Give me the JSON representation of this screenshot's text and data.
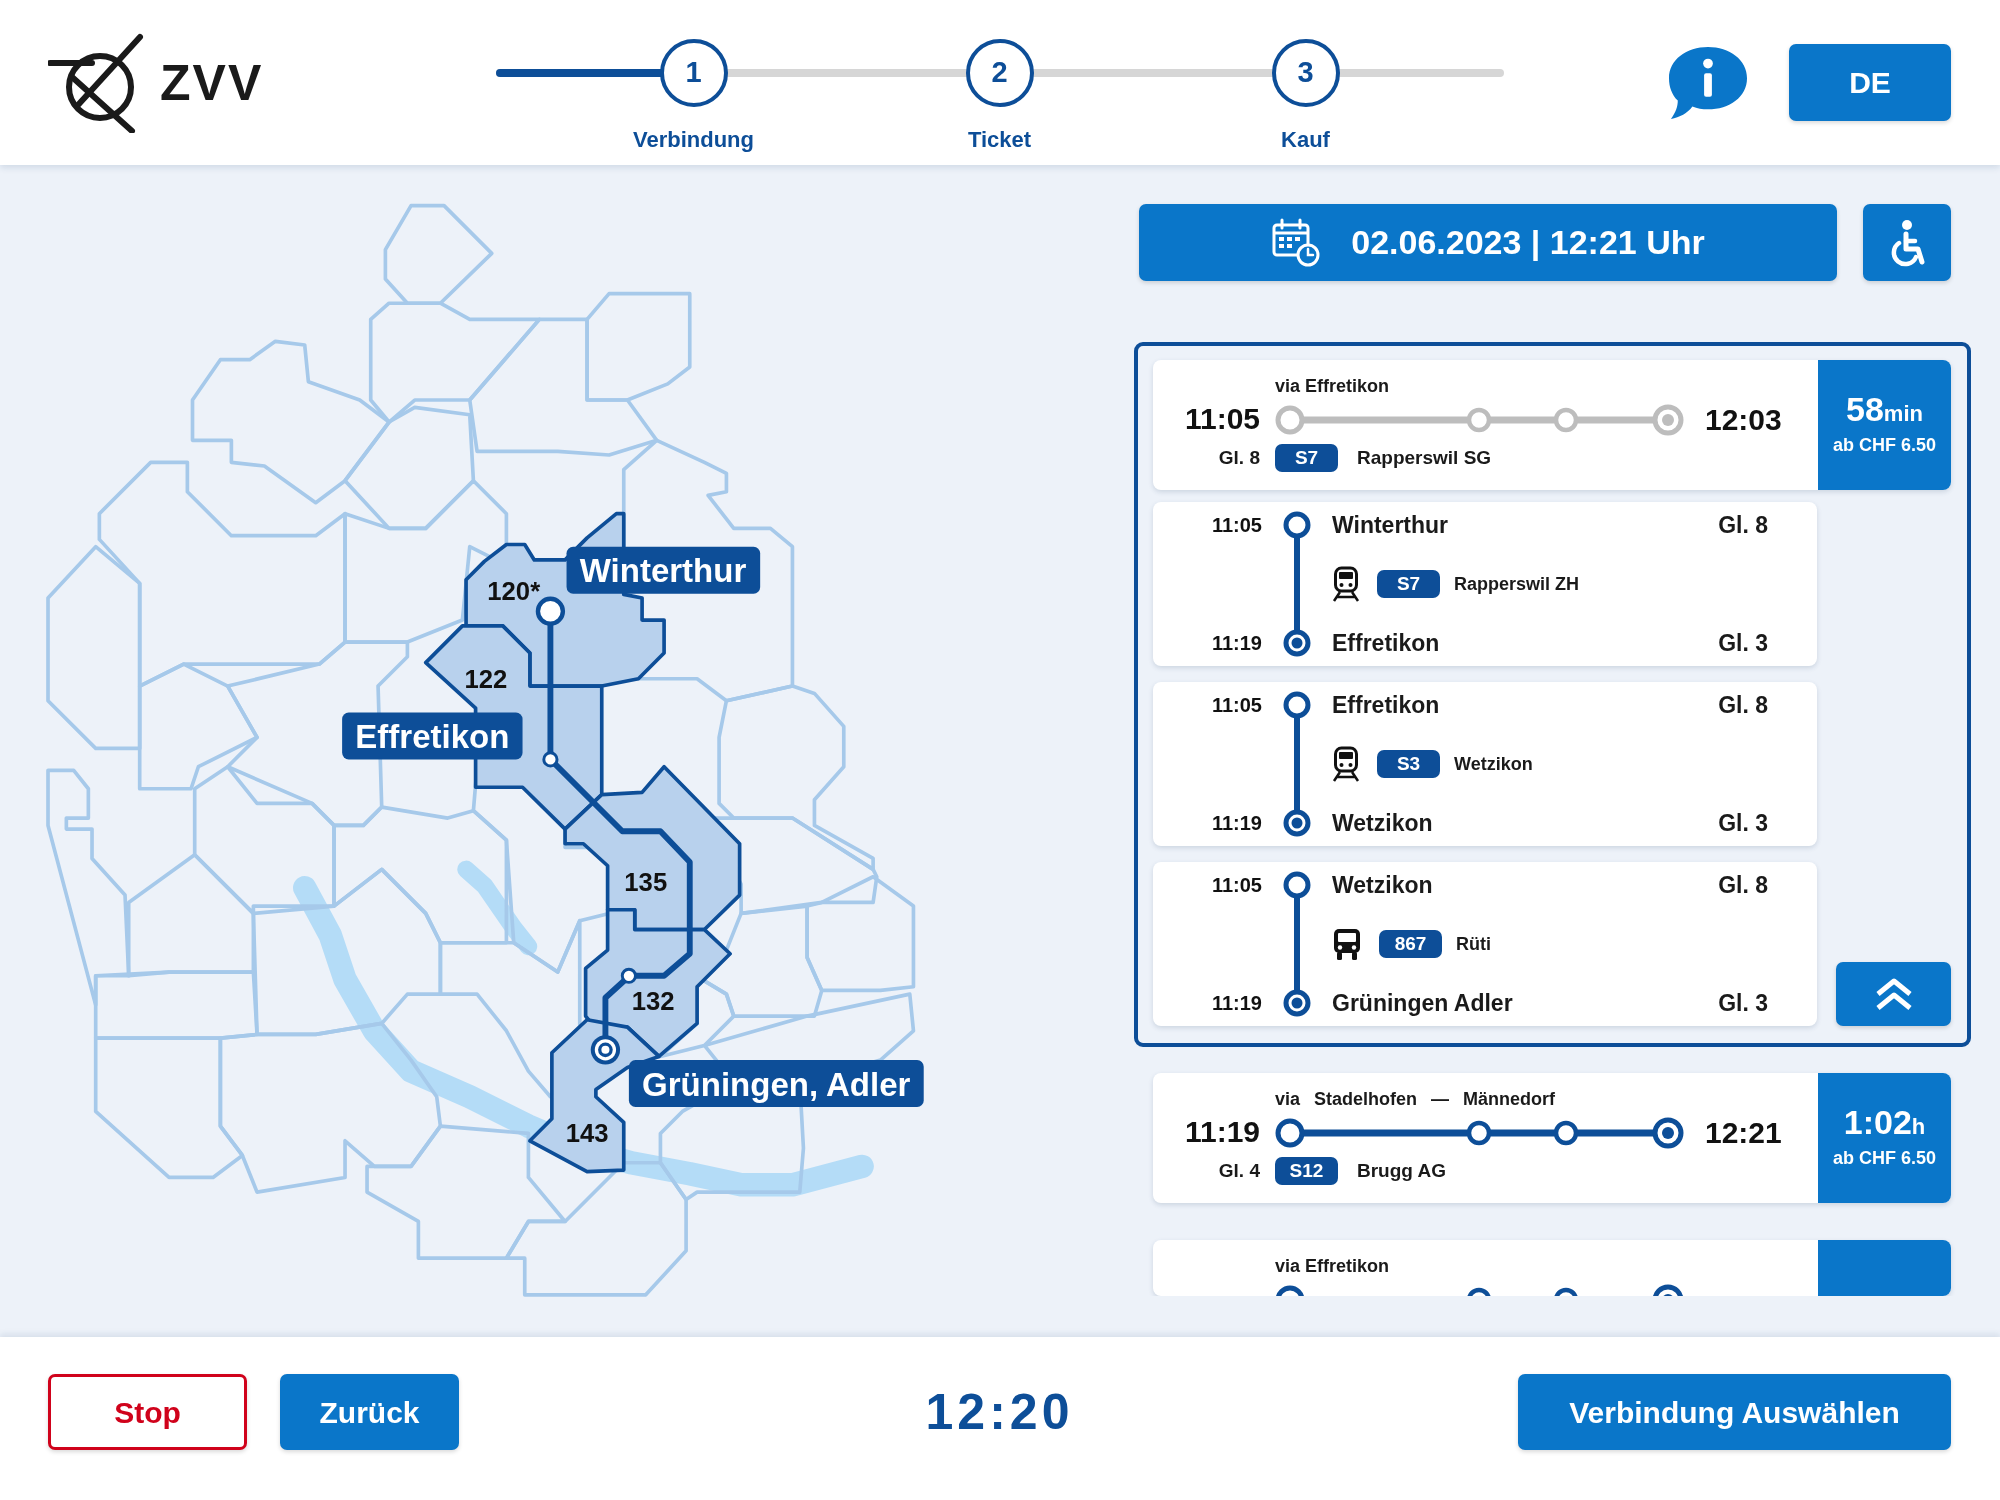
{
  "header": {
    "logo": "ZVV",
    "stepper": {
      "level": 0.2,
      "steps": [
        {
          "number": "1",
          "label": "Verbindung"
        },
        {
          "number": "2",
          "label": "Ticket"
        },
        {
          "number": "3",
          "label": "Kauf"
        }
      ]
    },
    "language_button": "DE"
  },
  "map": {
    "zones": [
      {
        "label": "120*",
        "highlighted": true
      },
      {
        "label": "122",
        "highlighted": true
      },
      {
        "label": "135",
        "highlighted": true
      },
      {
        "label": "132",
        "highlighted": true
      },
      {
        "label": "143",
        "highlighted": true
      }
    ],
    "stops": [
      {
        "label": "Winterthur"
      },
      {
        "label": "Effretikon"
      },
      {
        "label": "Grüningen, Adler"
      }
    ]
  },
  "date_button": "02.06.2023 | 12:21 Uhr",
  "connections": [
    {
      "selected": true,
      "expanded": true,
      "via": [
        "via Effretikon"
      ],
      "departure": "11:05",
      "arrival": "12:03",
      "platform": "Gl. 8",
      "line": "S7",
      "direction": "Rapperswil SG",
      "duration": "58",
      "duration_unit": "min",
      "price": "ab CHF 6.50",
      "legs": [
        {
          "kind": "train",
          "departure": "11:05",
          "from": "Winterthur",
          "from_platform": "Gl. 8",
          "line": "S7",
          "direction": "Rapperswil ZH",
          "arrival": "11:19",
          "to": "Effretikon",
          "to_platform": "Gl. 3"
        },
        {
          "kind": "train",
          "departure": "11:05",
          "from": "Effretikon",
          "from_platform": "Gl. 8",
          "line": "S3",
          "direction": "Wetzikon",
          "arrival": "11:19",
          "to": "Wetzikon",
          "to_platform": "Gl. 3"
        },
        {
          "kind": "bus",
          "departure": "11:05",
          "from": "Wetzikon",
          "from_platform": "Gl. 8",
          "line": "867",
          "direction": "Rüti",
          "arrival": "11:19",
          "to": "Grüningen Adler",
          "to_platform": "Gl. 3"
        }
      ]
    },
    {
      "selected": false,
      "expanded": false,
      "via": [
        "via",
        "Stadelhofen",
        "—",
        "Männedorf"
      ],
      "departure": "11:19",
      "arrival": "12:21",
      "platform": "Gl. 4",
      "line": "S12",
      "direction": "Brugg AG",
      "duration": "1:02",
      "duration_unit": "h",
      "price": "ab CHF 6.50"
    },
    {
      "selected": false,
      "expanded": false,
      "via": [
        "via Effretikon"
      ]
    }
  ],
  "footer": {
    "stop_button": "Stop",
    "back_button": "Zurück",
    "clock": "12:20",
    "confirm_button": "Verbindung Auswählen"
  }
}
